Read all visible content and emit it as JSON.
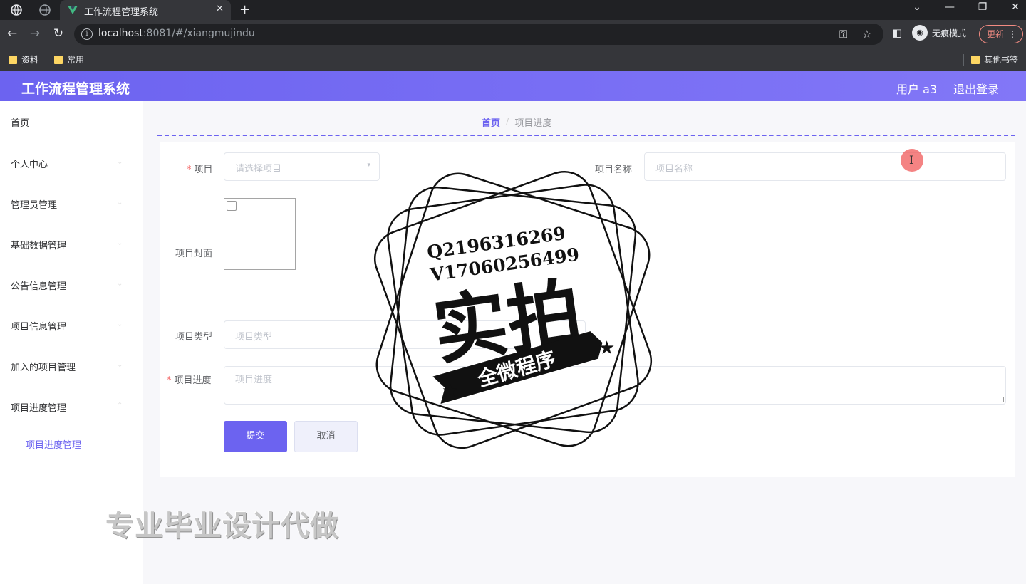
{
  "browser": {
    "tab_title": "工作流程管理系统",
    "url_host": "localhost",
    "url_rest": ":8081/#/xiangmujindu",
    "incognito_label": "无痕模式",
    "update_label": "更新",
    "bookmarks": [
      "资料",
      "常用"
    ],
    "other_bookmarks": "其他书签"
  },
  "header": {
    "title": "工作流程管理系统",
    "user": "用户 a3",
    "logout": "退出登录"
  },
  "sidebar": {
    "items": [
      "首页",
      "个人中心",
      "管理员管理",
      "基础数据管理",
      "公告信息管理",
      "项目信息管理",
      "加入的项目管理",
      "项目进度管理"
    ],
    "sub_item": "项目进度管理"
  },
  "breadcrumb": {
    "home": "首页",
    "current": "项目进度"
  },
  "form": {
    "project_label": "项目",
    "project_placeholder": "请选择项目",
    "name_label": "项目名称",
    "name_placeholder": "项目名称",
    "cover_label": "项目封面",
    "type_label": "项目类型",
    "type_placeholder": "项目类型",
    "progress_label": "项目进度",
    "progress_placeholder": "项目进度",
    "submit": "提交",
    "cancel": "取消"
  },
  "stamp": {
    "line1": "Q2196316269",
    "line2": "V17060256499",
    "big": "实拍",
    "banner": "全微程序"
  },
  "watermark": "专业毕业设计代做",
  "colors": {
    "accent": "#6c63f0",
    "required": "#f56c6c"
  }
}
